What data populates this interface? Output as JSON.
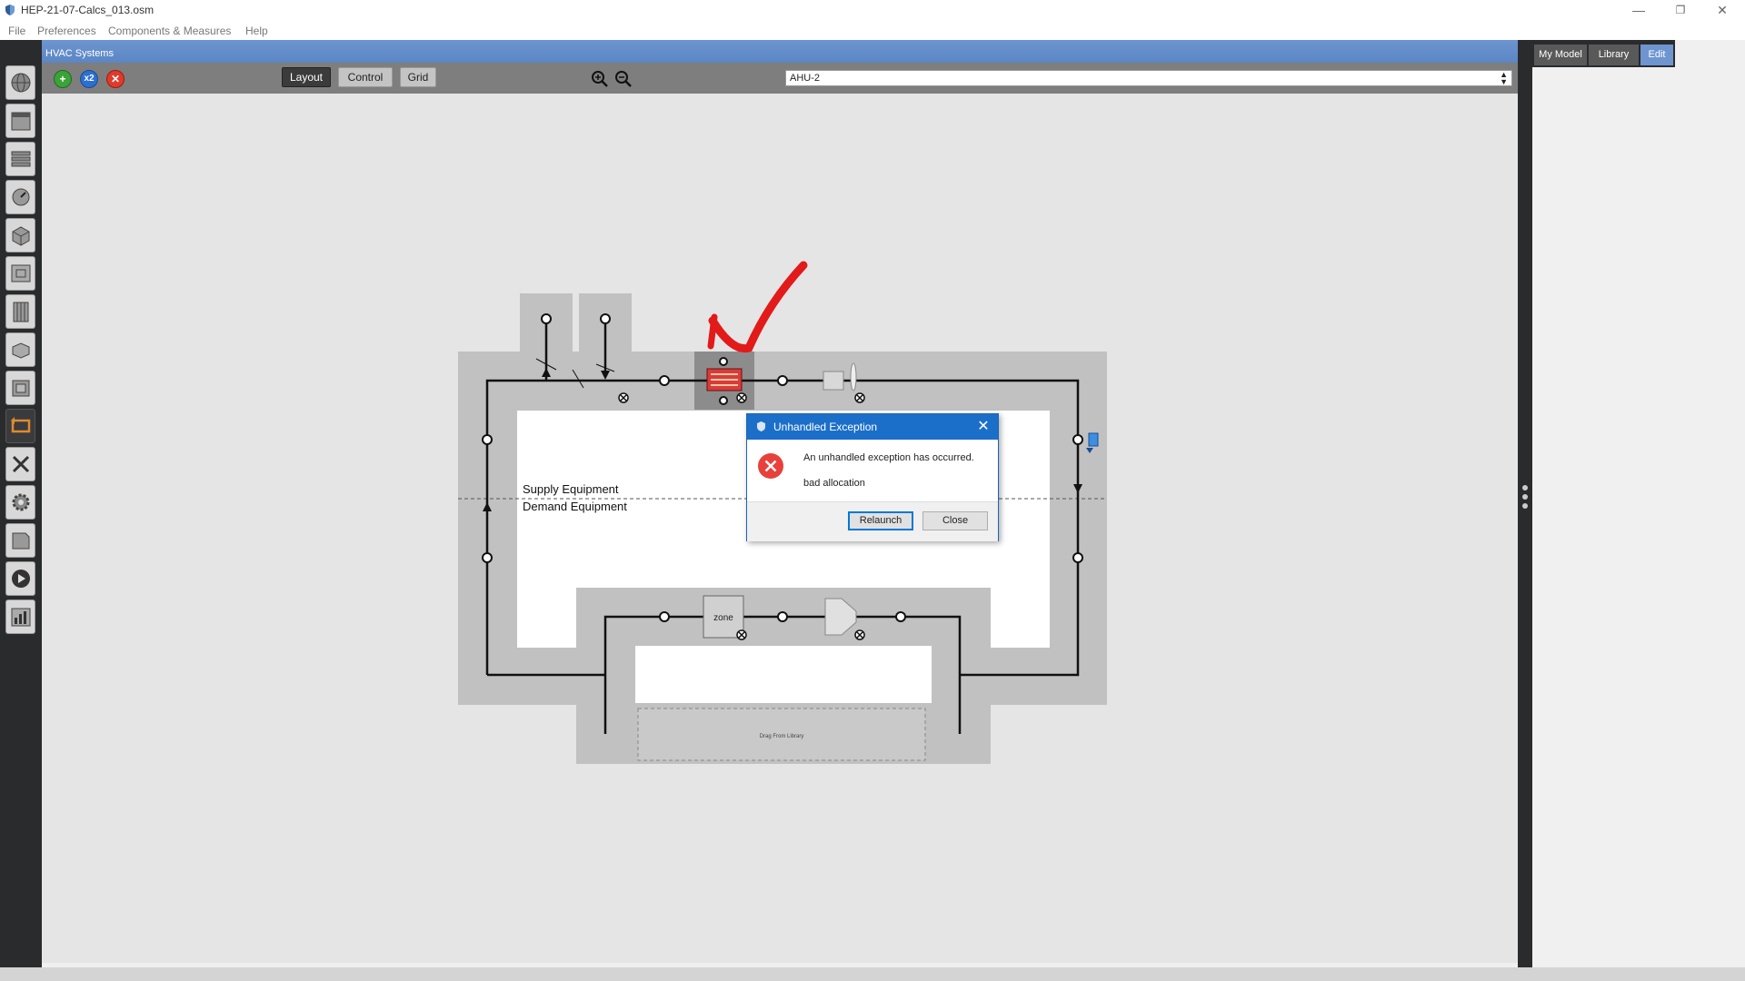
{
  "window": {
    "title": "HEP-21-07-Calcs_013.osm",
    "minimize": "—",
    "restore": "❐",
    "close": "✕"
  },
  "menu": [
    "File",
    "Preferences",
    "Components & Measures",
    "Help"
  ],
  "hvac": {
    "header": "HVAC Systems",
    "toolbar": {
      "add_icon": "+",
      "x2_icon": "x2",
      "remove_icon": "✕",
      "tabs": [
        "Layout",
        "Control",
        "Grid"
      ],
      "active_tab": "Layout",
      "zoom_in": "⊕",
      "zoom_out": "⊖",
      "loop_selected": "AHU-2"
    },
    "diagram": {
      "supply_label": "Supply Equipment",
      "demand_label": "Demand Equipment",
      "zone_label": "zone",
      "drag_label": "Drag From Library"
    }
  },
  "right_tabs": [
    "My Model",
    "Library",
    "Edit"
  ],
  "right_active_tab": "Edit",
  "dialog": {
    "title": "Unhandled Exception",
    "message": "An unhandled exception has occurred.",
    "detail": "bad allocation",
    "relaunch": "Relaunch",
    "close": "Close"
  },
  "colors": {
    "accent": "#1c6fc9",
    "hvac_header": "#6d95cf",
    "error": "#e8403a",
    "coil": "#d93b3b",
    "annotation": "#e21a1a"
  }
}
